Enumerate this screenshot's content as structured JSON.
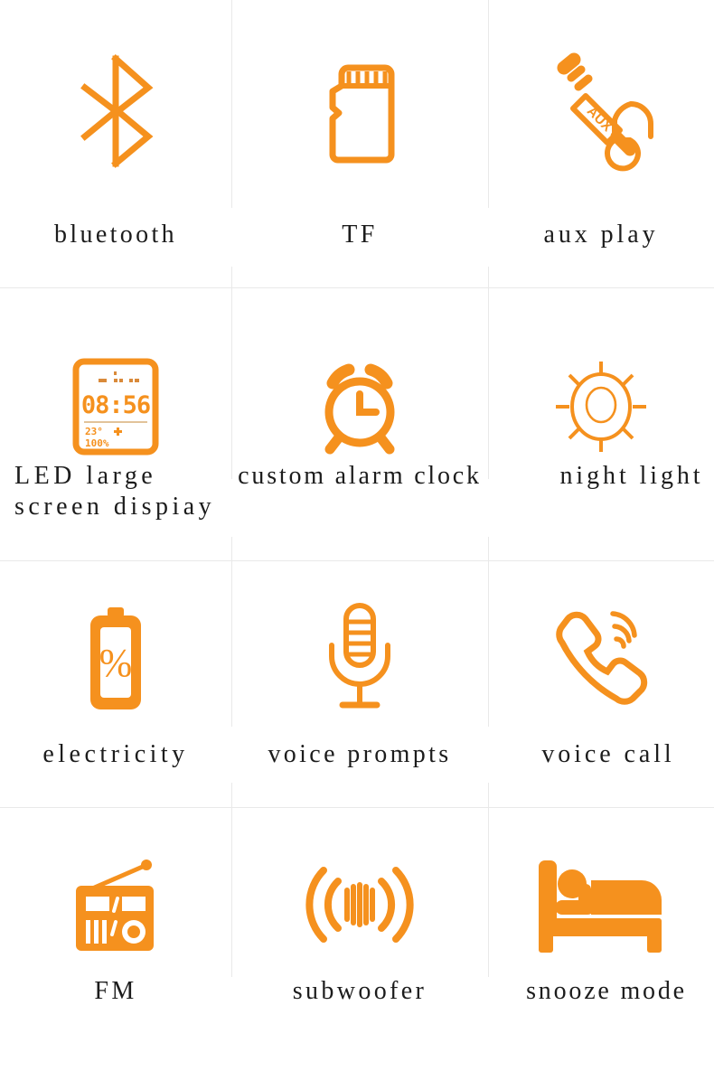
{
  "accent_color": "#F5911E",
  "divider_color": "#E9E9E9",
  "background_color": "#FFFFFF",
  "text_color": "#1C1C1C",
  "grid": {
    "columns": 3,
    "rows": 4
  },
  "features": [
    {
      "id": "bluetooth",
      "label": "bluetooth",
      "icon": "bluetooth-icon",
      "row": 1,
      "col": 1
    },
    {
      "id": "tf",
      "label": "TF",
      "icon": "tf-card-icon",
      "row": 1,
      "col": 2
    },
    {
      "id": "aux_play",
      "label": "aux play",
      "icon": "aux-plug-icon",
      "row": 1,
      "col": 3
    },
    {
      "id": "led_display",
      "label": "LED large\nscreen dispiay",
      "icon": "led-screen-icon",
      "row": 2,
      "col": 1
    },
    {
      "id": "alarm_clock",
      "label": "custom alarm clock",
      "icon": "alarm-clock-icon",
      "row": 2,
      "col": 2
    },
    {
      "id": "night_light",
      "label": "night light",
      "icon": "night-light-icon",
      "row": 2,
      "col": 3
    },
    {
      "id": "electricity",
      "label": "electricity",
      "icon": "battery-icon",
      "row": 3,
      "col": 1
    },
    {
      "id": "voice_prompts",
      "label": "voice prompts",
      "icon": "microphone-icon",
      "row": 3,
      "col": 2
    },
    {
      "id": "voice_call",
      "label": "voice call",
      "icon": "phone-call-icon",
      "row": 3,
      "col": 3
    },
    {
      "id": "fm",
      "label": "FM",
      "icon": "radio-icon",
      "row": 4,
      "col": 1
    },
    {
      "id": "subwoofer",
      "label": "subwoofer",
      "icon": "subwoofer-icon",
      "row": 4,
      "col": 2
    },
    {
      "id": "snooze_mode",
      "label": "snooze mode",
      "icon": "bed-icon",
      "row": 4,
      "col": 3
    }
  ],
  "led_screen": {
    "time": "08:56",
    "temperature": "23°",
    "battery": "100%"
  }
}
